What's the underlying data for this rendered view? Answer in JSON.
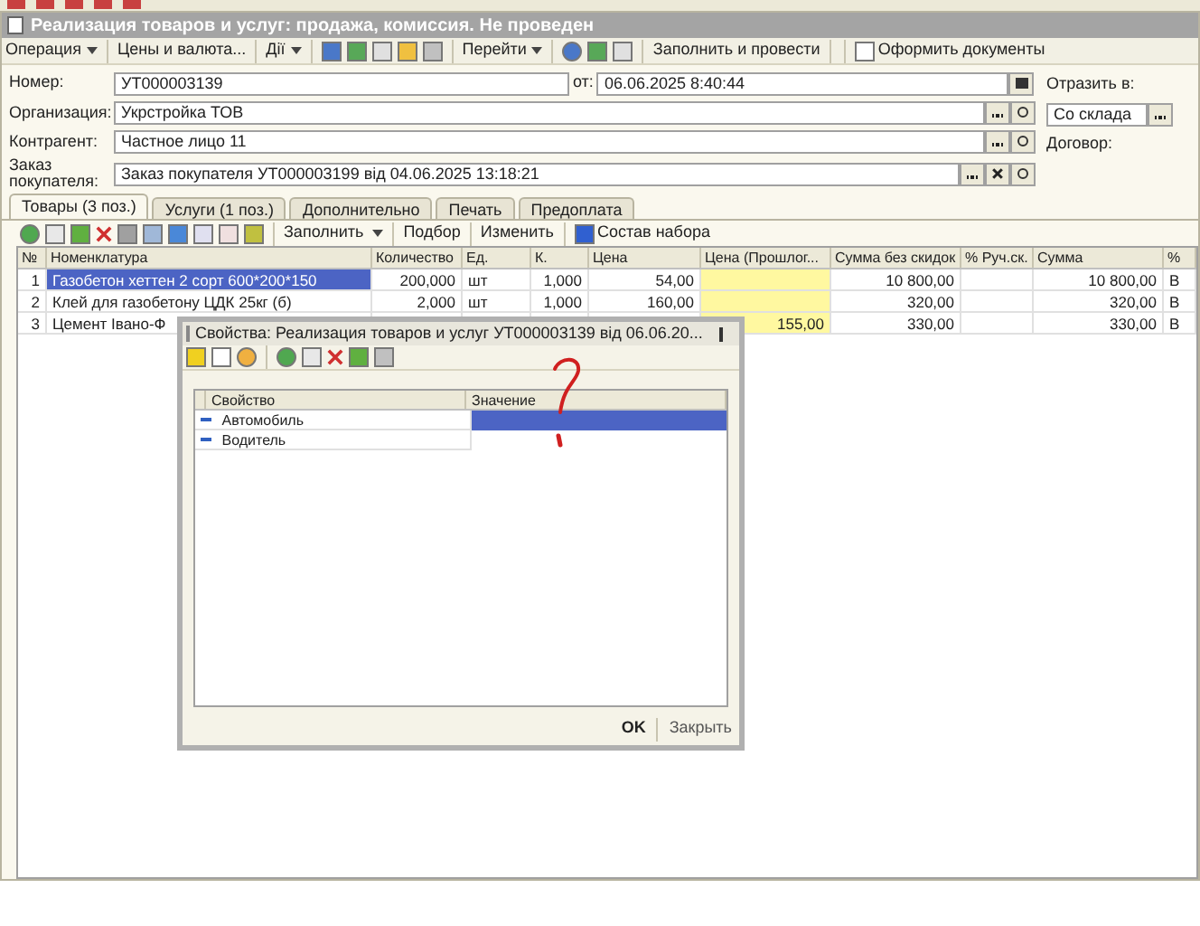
{
  "window": {
    "title": "Реализация товаров и услуг: продажа, комиссия. Не проведен"
  },
  "toolbar": {
    "items": [
      {
        "kind": "menu",
        "label": "Операция"
      },
      {
        "kind": "text",
        "label": "Цены и валюта..."
      },
      {
        "kind": "menu",
        "label": "Дії"
      },
      {
        "kind": "icons"
      },
      {
        "kind": "menu",
        "label": "Перейти"
      },
      {
        "kind": "icons"
      },
      {
        "kind": "text",
        "label": "Заполнить и провести"
      },
      {
        "kind": "doc",
        "label": "Оформить документы"
      }
    ]
  },
  "form": {
    "number_label": "Номер:",
    "number": "УТ000003139",
    "date_label": "от:",
    "date": "06.06.2025  8:40:44",
    "fields": [
      {
        "label": "Организация:",
        "value": "Укрстройка ТОВ",
        "clear": false
      },
      {
        "label": "Контрагент:",
        "value": "Частное лицо 11",
        "clear": false
      },
      {
        "label": "Заказ покупателя:",
        "value": "Заказ покупателя УТ000003199 від 04.06.2025 13:18:21",
        "clear": true
      }
    ],
    "reflect_label": "Отразить в:",
    "reflect_value": "Со склада",
    "contract_label": "Договор:"
  },
  "tabs": [
    {
      "label": "Товары (3 поз.)",
      "selected": true
    },
    {
      "label": "Услуги (1 поз.)",
      "selected": false
    },
    {
      "label": "Дополнительно",
      "selected": false
    },
    {
      "label": "Печать",
      "selected": false
    },
    {
      "label": "Предоплата",
      "selected": false
    }
  ],
  "table_toolbar": [
    "Заполнить",
    "Подбор",
    "Изменить",
    "Состав набора"
  ],
  "table": {
    "columns": [
      {
        "label": "№",
        "highlighted": false
      },
      {
        "label": "Номенклатура",
        "highlighted": false
      },
      {
        "label": "Количество",
        "highlighted": false
      },
      {
        "label": "Ед.",
        "highlighted": false
      },
      {
        "label": "К.",
        "highlighted": false
      },
      {
        "label": "Цена",
        "highlighted": false
      },
      {
        "label": "Цена (Прошлог...",
        "highlighted": true
      },
      {
        "label": "Сумма без скидок",
        "highlighted": false
      },
      {
        "label": "% Руч.ск.",
        "highlighted": false
      },
      {
        "label": "Сумма",
        "highlighted": false
      },
      {
        "label": "%",
        "highlighted": false
      }
    ],
    "rows": [
      {
        "selected": true,
        "cells": [
          "1",
          "Газобетон хеттен 2 сорт 600*200*150",
          "200,000",
          "шт",
          "1,000",
          "54,00",
          null,
          "10 800,00",
          null,
          "10 800,00",
          "В"
        ]
      },
      {
        "selected": false,
        "cells": [
          "2",
          "Клей для газобетону ЦДК 25кг (б)",
          "2,000",
          "шт",
          "1,000",
          "160,00",
          null,
          "320,00",
          null,
          "320,00",
          "В"
        ]
      },
      {
        "selected": false,
        "cells": [
          "3",
          "Цемент Івано-Ф",
          null,
          null,
          null,
          null,
          "155,00",
          "330,00",
          null,
          "330,00",
          "В"
        ]
      }
    ]
  },
  "dialog": {
    "title": "Свойства: Реализация товаров и услуг УТ000003139 від 06.06.20...",
    "columns": [
      "Свойство",
      "Значение"
    ],
    "rows": [
      {
        "name": "Автомобиль",
        "selected": true
      },
      {
        "name": "Водитель",
        "selected": false
      }
    ],
    "buttons": [
      {
        "label": "OK",
        "default": true
      },
      {
        "label": "Закрыть",
        "default": false
      }
    ]
  }
}
